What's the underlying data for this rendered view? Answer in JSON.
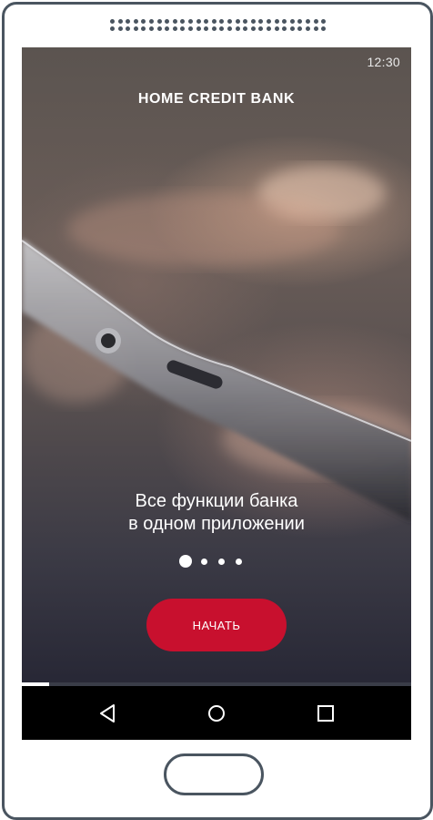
{
  "status_bar": {
    "time": "12:30"
  },
  "brand": {
    "logo_text": "HOME CREDIT BANK"
  },
  "onboarding": {
    "headline_line1": "Все функции банка",
    "headline_line2": "в одном приложении",
    "page_count": 4,
    "current_page": 1,
    "progress": 0.07
  },
  "actions": {
    "start_label": "НАЧАТЬ"
  },
  "nav_bar": {
    "icons": [
      "back-icon",
      "home-icon",
      "recents-icon"
    ]
  },
  "colors": {
    "accent": "#c8102e",
    "frame": "#4a5560",
    "nav_bg": "#000000"
  }
}
